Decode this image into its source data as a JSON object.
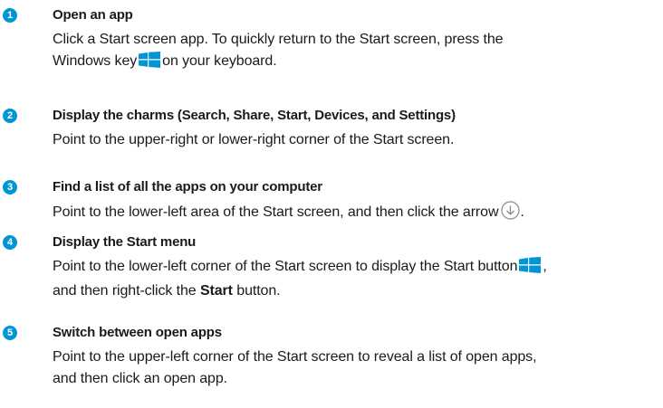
{
  "steps": [
    {
      "number": "1",
      "title": "Open an app",
      "line1": "Click a Start screen app. To quickly return to the Start screen, press the",
      "line2_before": "Windows key",
      "line2_after": "on your keyboard."
    },
    {
      "number": "2",
      "title": "Display the charms (Search, Share, Start, Devices, and Settings)",
      "line1": "Point to the upper-right or lower-right corner of the Start screen."
    },
    {
      "number": "3",
      "title": "Find a list of all the apps on your computer",
      "line1": "Point to the lower-left area of the Start screen, and then click the arrow",
      "line1_after": "."
    },
    {
      "number": "4",
      "title": "Display the Start menu",
      "line1": "Point to the lower-left corner of the Start screen to display the Start button",
      "line1_after": ",",
      "line2_before": "and then right-click the",
      "line2_bold": "Start",
      "line2_after": "button."
    },
    {
      "number": "5",
      "title": "Switch between open apps",
      "line1": "Point to the upper-left corner of the Start screen to reveal a list of open apps,",
      "line2": "and then click an open app."
    }
  ],
  "colors": {
    "accent": "#0096d6",
    "text": "#1a1a1a"
  },
  "icons": [
    "windows-logo-icon",
    "down-arrow-circle-icon"
  ]
}
